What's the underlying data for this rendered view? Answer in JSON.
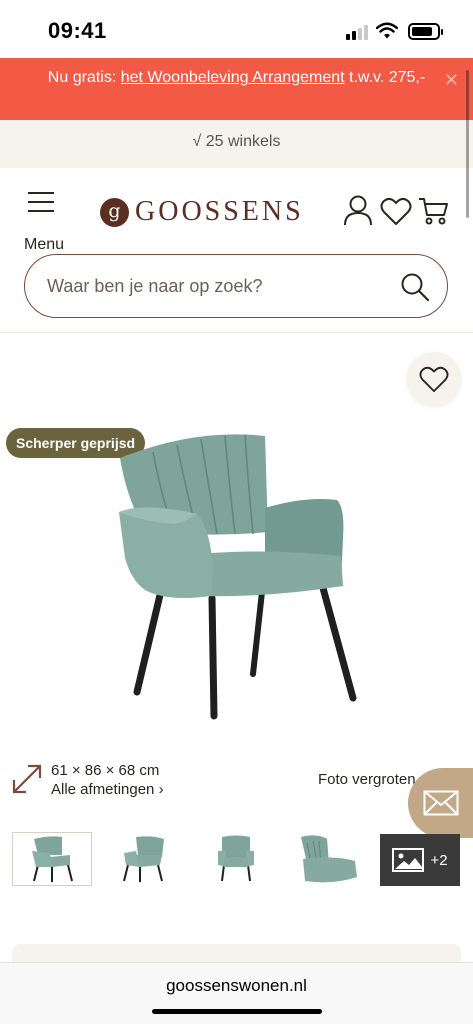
{
  "status_bar": {
    "time": "09:41"
  },
  "promo": {
    "prefix": "Nu gratis: ",
    "link_text": "het Woonbeleving Arrangement",
    "suffix": " t.w.v. 275,-"
  },
  "stores": {
    "label": "√ 25 winkels"
  },
  "header": {
    "menu_label": "Menu",
    "logo_mark": "g",
    "logo_text": "GOOSSENS",
    "icons": [
      "account-icon",
      "heart-icon",
      "cart-icon"
    ]
  },
  "search": {
    "placeholder": "Waar ben je naar op zoek?"
  },
  "product": {
    "badge": "Scherper geprijsd",
    "chair_color": "#7fa49a"
  },
  "dimensions": {
    "value": "61 × 86 × 68 cm",
    "link": "Alle afmetingen ›"
  },
  "zoom": {
    "label": "Foto vergroten"
  },
  "thumbnails": {
    "more_label": "+2"
  },
  "browser": {
    "url": "goossenswonen.nl"
  },
  "colors": {
    "promo": "#f25a45",
    "brand": "#5b2e22",
    "badge": "#6b633d",
    "accent_tan": "#c3a887"
  }
}
